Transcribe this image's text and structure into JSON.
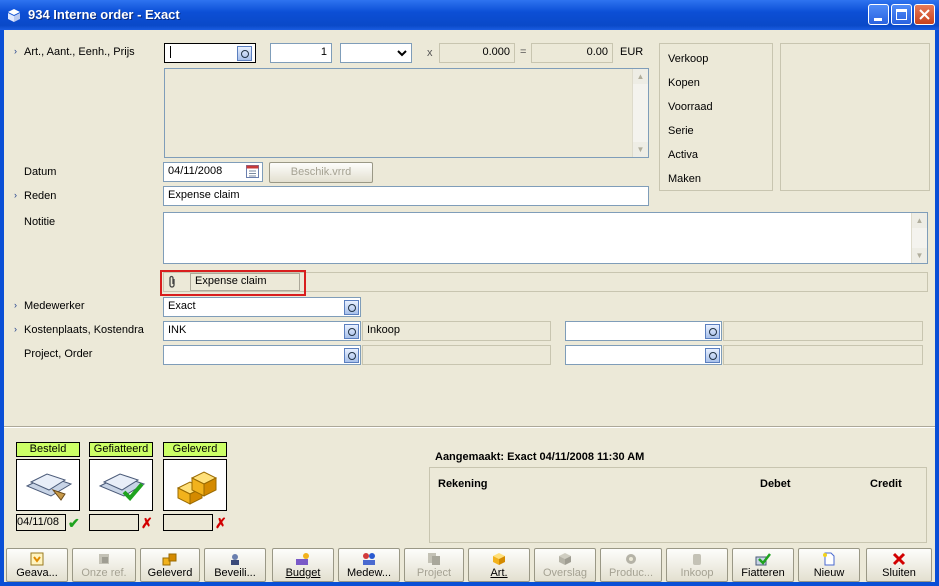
{
  "window": {
    "title": "934 Interne order - Exact"
  },
  "item_row": {
    "label": "Art., Aant., Eenh., Prijs",
    "article_value": "",
    "quantity": "1",
    "unit": "",
    "times": "x",
    "price": "0.000",
    "equals": "=",
    "total": "0.00",
    "currency": "EUR"
  },
  "side_menu": [
    "Verkoop",
    "Kopen",
    "Voorraad",
    "Serie",
    "Activa",
    "Maken"
  ],
  "form": {
    "datum_label": "Datum",
    "datum_value": "04/11/2008",
    "beschik_button": "Beschik.vrrd",
    "reden_label": "Reden",
    "reden_value": "Expense claim",
    "notitie_label": "Notitie",
    "notitie_value": "",
    "attachment_value": "Expense claim",
    "medewerker_label": "Medewerker",
    "medewerker_value": "Exact",
    "kostenplaats_label": "Kostenplaats, Kostendra",
    "kostenplaats_value": "INK",
    "kostenplaats_desc": "Inkoop",
    "kostendrager_value": "",
    "project_label": "Project, Order",
    "project_value": "",
    "order_value": ""
  },
  "status": [
    {
      "label": "Besteld",
      "date": "04/11/08",
      "ok": true
    },
    {
      "label": "Gefiatteerd",
      "date": "",
      "ok": false
    },
    {
      "label": "Geleverd",
      "date": "",
      "ok": false
    }
  ],
  "info": {
    "created": "Aangemaakt: Exact 04/11/2008 11:30 AM",
    "col_rekening": "Rekening",
    "col_debet": "Debet",
    "col_credit": "Credit"
  },
  "toolbar": [
    {
      "label": "Geava...",
      "enabled": true,
      "icon": "export-icon"
    },
    {
      "label": "Onze ref.",
      "enabled": false,
      "icon": "reference-icon"
    },
    {
      "label": "Geleverd",
      "enabled": true,
      "icon": "boxes-icon"
    },
    {
      "label": "Beveili...",
      "enabled": true,
      "icon": "security-icon"
    },
    {
      "label": "Budget",
      "enabled": true,
      "icon": "budget-icon"
    },
    {
      "label": "Medew...",
      "enabled": true,
      "icon": "people-icon"
    },
    {
      "label": "Project",
      "enabled": false,
      "icon": "project-icon"
    },
    {
      "label": "Art.",
      "enabled": true,
      "icon": "article-icon"
    },
    {
      "label": "Overslag",
      "enabled": false,
      "icon": "transfer-icon"
    },
    {
      "label": "Produc...",
      "enabled": false,
      "icon": "gear-icon"
    },
    {
      "label": "Inkoop",
      "enabled": false,
      "icon": "purchase-icon"
    },
    {
      "label": "Fiatteren",
      "enabled": true,
      "icon": "approve-icon"
    },
    {
      "label": "Nieuw",
      "enabled": true,
      "icon": "new-document-icon"
    },
    {
      "label": "Sluiten",
      "enabled": true,
      "icon": "close-icon"
    }
  ]
}
